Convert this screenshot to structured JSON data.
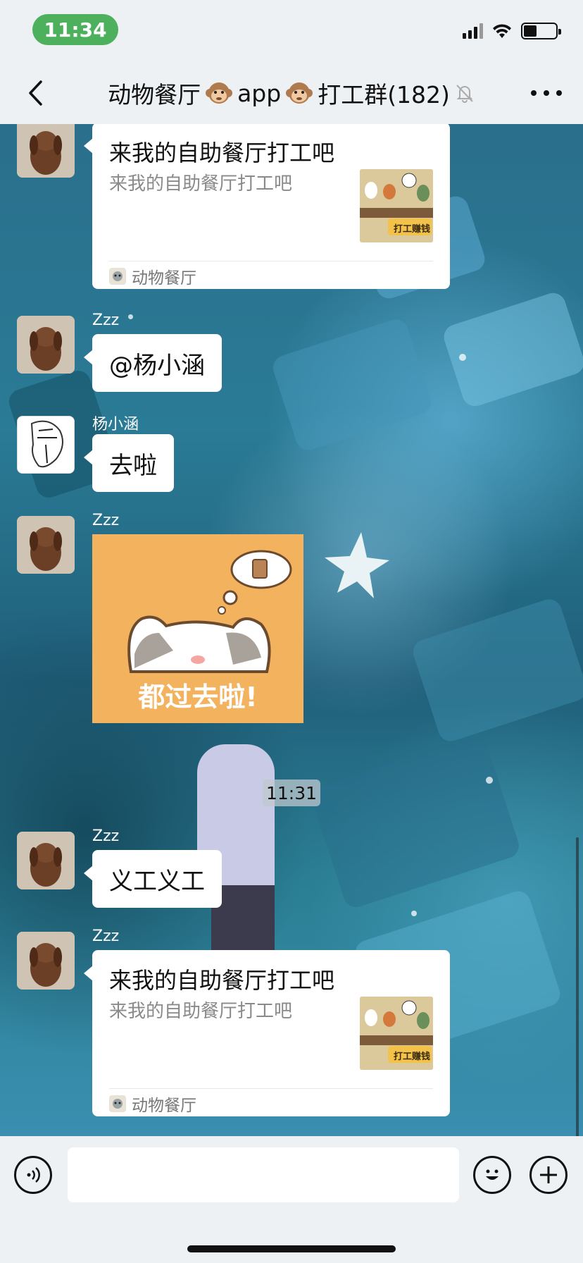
{
  "status_bar": {
    "time": "11:34"
  },
  "nav": {
    "title_part1": "动物餐厅",
    "title_part2": "app",
    "title_part3": "打工群(182)"
  },
  "messages": {
    "card_top": {
      "title": "来我的自助餐厅打工吧",
      "desc": "来我的自助餐厅打工吧",
      "source": "动物餐厅",
      "thumb_label": "打工赚钱"
    },
    "msg1": {
      "sender": "Zzz",
      "text": "@杨小涵"
    },
    "msg2": {
      "sender": "杨小涵",
      "text": "去啦"
    },
    "msg3": {
      "sender": "Zzz",
      "sticker_text": "都过去啦!"
    },
    "timestamp": "11:31",
    "msg4": {
      "sender": "Zzz",
      "text": "义工义工"
    },
    "msg5": {
      "sender": "Zzz",
      "title": "来我的自助餐厅打工吧",
      "desc": "来我的自助餐厅打工吧",
      "source": "动物餐厅",
      "thumb_label": "打工赚钱"
    }
  },
  "input": {
    "placeholder": ""
  },
  "colors": {
    "time_pill": "#4cb05d",
    "bar_bg": "#eef1f4",
    "bubble": "#ffffff",
    "sticker_bg": "#f2b25e"
  },
  "icons": [
    "back-icon",
    "monkey-icon",
    "mute-icon",
    "more-icon",
    "voice-icon",
    "emoji-icon",
    "plus-icon"
  ]
}
